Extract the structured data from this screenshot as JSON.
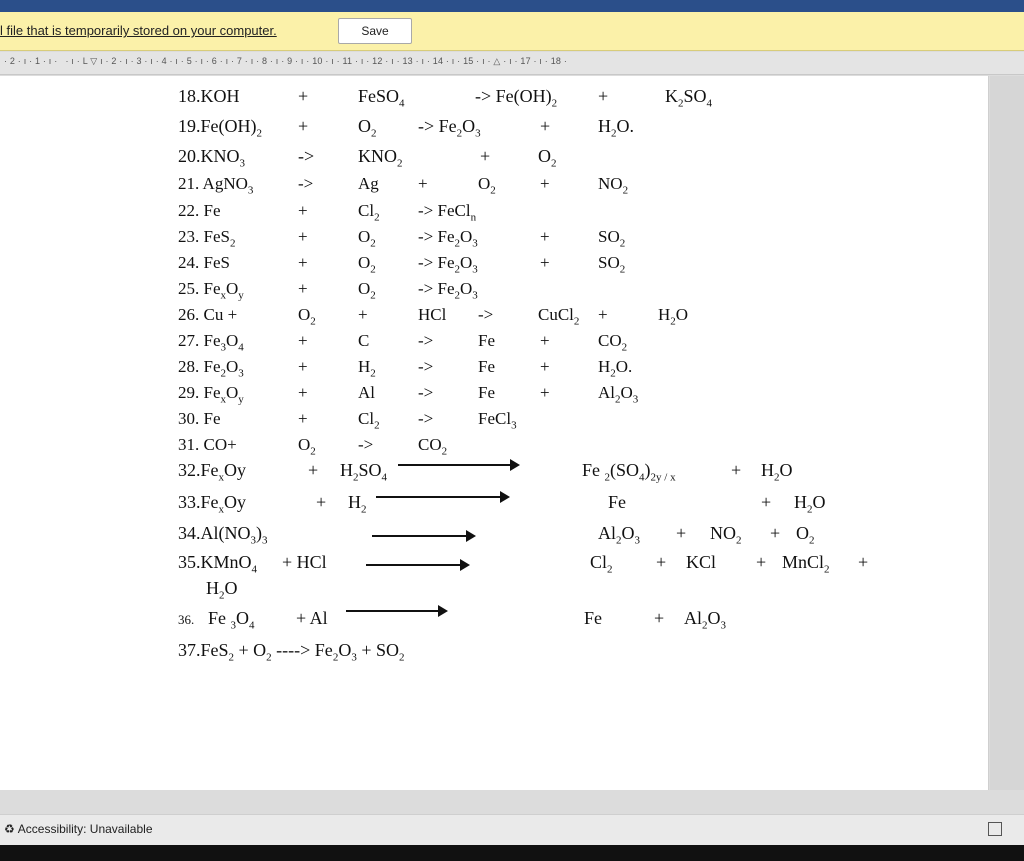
{
  "infobar": {
    "message": "l file that is temporarily stored on your computer.",
    "save_label": "Save"
  },
  "ruler": {
    "text": "· 2 · ı · 1 · ı ·   · ı · L ▽ ı · 2 · ı · 3 · ı · 4 · ı · 5 · ı · 6 · ı · 7 · ı · 8 · ı · 9 · ı · 10 · ı · 11 · ı · 12 · ı · 13 · ı · 14 · ı · 15 · ı · △ · ı · 17 · ı · 18 ·"
  },
  "statusbar": {
    "accessibility": "Accessibility: Unavailable"
  },
  "equations": {
    "r18": {
      "n": "18.KOH",
      "p": "+",
      "b": "FeSO",
      "b4": "4",
      "arr": "-> Fe(OH)",
      "s2": "2",
      "p2": "+",
      "k": "K",
      "k2": "2",
      "so": "SO",
      "so4": "4"
    },
    "r19": {
      "n": "19.Fe(OH)",
      "n2": "2",
      "p": "+",
      "o": "O",
      "o2": "2",
      "arr": "-> Fe",
      "fe2": "2",
      "o3": "O",
      "o3s": "3",
      "p2": "+",
      "h": "H",
      "h2": "2",
      "ho": "O."
    },
    "r20": {
      "n": "20.KNO",
      "n3": "3",
      "arr": "->",
      "k": "KNO",
      "k2": "2",
      "p": "+",
      "o": "O",
      "o2": "2"
    },
    "r21": {
      "n": "21. AgNO",
      "n3": "3",
      "arr": "->",
      "ag": "Ag",
      "p": "+",
      "o": "O",
      "o2": "2",
      "p2": "+",
      "no": "NO",
      "no2": "2"
    },
    "r22": {
      "n": "22. Fe",
      "p": "+",
      "cl": "Cl",
      "cl2": "2",
      "arr": "-> FeCl",
      "sub": "n"
    },
    "r23": {
      "n": "23. FeS",
      "n2": "2",
      "p": "+",
      "o": "O",
      "o2": "2",
      "arr": "-> Fe",
      "f2": "2",
      "o3": "O",
      "o3s": "3",
      "p2": "+",
      "so": "SO",
      "so2": "2"
    },
    "r24": {
      "n": "24. FeS",
      "p": "+",
      "o": "O",
      "o2": "2",
      "arr": "-> Fe",
      "f2": "2",
      "o3": "O",
      "o3s": "3",
      "p2": "+",
      "so": "SO",
      "so2": "2"
    },
    "r25": {
      "n": "25. Fe",
      "x": "x",
      "o": "O",
      "y": "y",
      "p": "+",
      "o2a": "O",
      "o2": "2",
      "arr": "-> Fe",
      "f2": "2",
      "o3": "O",
      "o3s": "3"
    },
    "r26": {
      "n": "26. Cu +",
      "o": "O",
      "o2": "2",
      "p": "+",
      "hcl": "HCl",
      "arr": "->",
      "cu": "CuCl",
      "cu2": "2",
      "p2": "+",
      "h": "H",
      "h2": "2",
      "ho": "O"
    },
    "r27": {
      "n": "27. Fe",
      "n3": "3",
      "o": "O",
      "o4": "4",
      "p": "+",
      "c": "C",
      "arr": "->",
      "fe": "Fe",
      "p2": "+",
      "co": "CO",
      "co2": "2"
    },
    "r28": {
      "n": "28. Fe",
      "n2": "2",
      "o": "O",
      "o3": "3",
      "p": "+",
      "h": "H",
      "h2": "2",
      "arr": "->",
      "fe": "Fe",
      "p2": "+",
      "hh": "H",
      "hh2": "2",
      "ho": "O."
    },
    "r29": {
      "n": "29. Fe",
      "x": "x",
      "o": "O",
      "y": "y",
      "p": "+",
      "al": "Al",
      "arr": "->",
      "fe": "Fe",
      "p2": "+",
      "al2": "Al",
      "al2s": "2",
      "o3": "O",
      "o3s": "3"
    },
    "r30": {
      "n": "30. Fe",
      "p": "+",
      "cl": "Cl",
      "cl2": "2",
      "arr": "->",
      "fecl": "FeCl",
      "fecl3": "3"
    },
    "r31": {
      "n": "31. CO+",
      "o": "O",
      "o2": "2",
      "arr": "->",
      "co": "CO",
      "co2": "2"
    },
    "r32": {
      "n": "32.Fe",
      "x": "x",
      "oy": "Oy",
      "p": "+",
      "h": "H",
      "h2": "2",
      "so": "SO",
      "so4": "4",
      "prod": "Fe",
      "p2s": "2",
      "so4p": "(SO",
      "so4s": "4",
      "close": ")",
      "yx": "2y / x",
      "p2": "+",
      "hh": "H",
      "hh2": "2",
      "ho": "O"
    },
    "r33": {
      "n": "33.Fe",
      "x": "x",
      "oy": "Oy",
      "p": "+",
      "h": "H",
      "h2": "2",
      "fe": "Fe",
      "p2": "+",
      "hh": "H",
      "hh2": "2",
      "ho": "O"
    },
    "r34": {
      "n": "34.Al(NO",
      "n3": "3",
      "close": ")",
      "c3": "3",
      "al": "Al",
      "al2": "2",
      "o": "O",
      "o3": "3",
      "p": "+",
      "no": "NO",
      "no2": "2",
      "p2": "+",
      "oo": "O",
      "oo2": "2"
    },
    "r35": {
      "n": "35.KMnO",
      "n4": "4",
      "p": "+ HCl",
      "cl": "Cl",
      "cl2": "2",
      "p2": "+",
      "kcl": "KCl",
      "p3": "+",
      "mn": "MnCl",
      "mn2": "2",
      "p4": "+",
      "h": "H",
      "h2": "2",
      "ho": "O"
    },
    "r36": {
      "n": "36.",
      "fe": "Fe",
      "fe3": "3",
      "o": "O",
      "o4": "4",
      "p": "+ Al",
      "prod": "Fe",
      "p2": "+",
      "al": "Al",
      "al2": "2",
      "o3": "O",
      "o3s": "3"
    },
    "r37": {
      "n": "37.FeS",
      "n2": "2",
      "p": "+ O",
      "o2": "2",
      "arr": "----> Fe",
      "f2": "2",
      "o": "O",
      "o3": "3",
      "p2": "+ SO",
      "so2": "2"
    }
  }
}
